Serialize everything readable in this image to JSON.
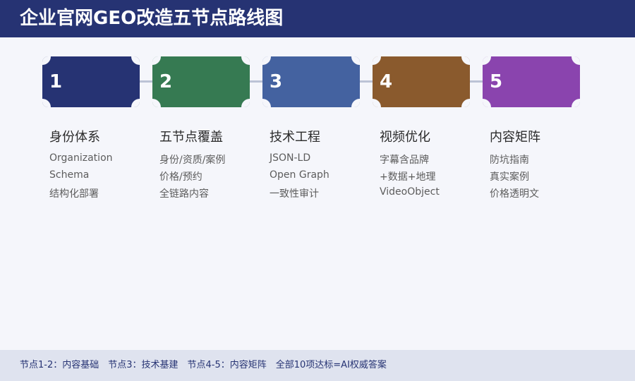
{
  "header": {
    "title": "企业官网GEO改造五节点路线图"
  },
  "steps": [
    {
      "number": "1",
      "color": "#263373",
      "title": "身份体系",
      "lines": [
        "Organization",
        "Schema",
        "结构化部署"
      ]
    },
    {
      "number": "2",
      "color": "#367a52",
      "title": "五节点覆盖",
      "lines": [
        "身份/资质/案例",
        "价格/预约",
        "全链路内容"
      ]
    },
    {
      "number": "3",
      "color": "#4462a0",
      "title": "技术工程",
      "lines": [
        "JSON-LD",
        "Open Graph",
        "一致性审计"
      ]
    },
    {
      "number": "4",
      "color": "#8a5a2d",
      "title": "视频优化",
      "lines": [
        "字幕含品牌",
        "+数据+地理",
        "VideoObject"
      ]
    },
    {
      "number": "5",
      "color": "#8a44ae",
      "title": "内容矩阵",
      "lines": [
        "防坑指南",
        "真实案例",
        "价格透明文"
      ]
    }
  ],
  "footer": {
    "text": "节点1-2：内容基础　节点3：技术基建　节点4-5：内容矩阵　全部10项达标=AI权威答案"
  }
}
